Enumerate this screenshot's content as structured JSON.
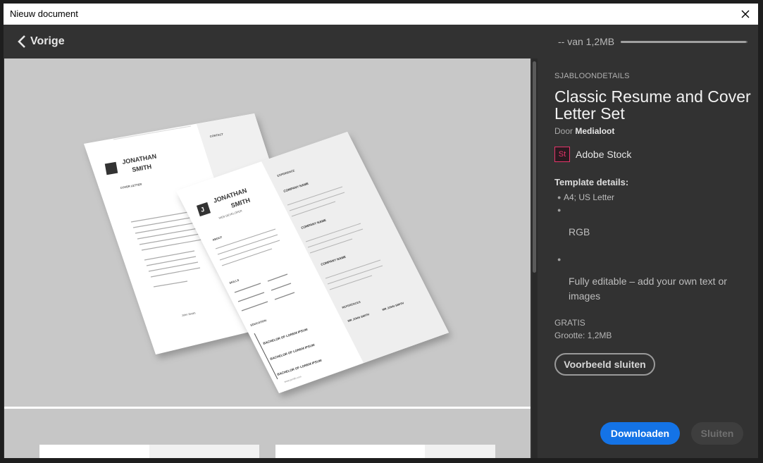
{
  "window": {
    "title": "Nieuw document"
  },
  "topbar": {
    "back_label": "Vorige",
    "progress_text": "-- van 1,2MB",
    "progress": 0.99
  },
  "details": {
    "heading": "SJABLOONDETAILS",
    "title": "Classic Resume and Cover Letter Set",
    "by_prefix": "Door",
    "author": "Medialoot",
    "source_badge": "St",
    "source": "Adobe Stock",
    "template_heading": "Template details:",
    "items": [
      "A4; US Letter",
      "RGB",
      "Fully editable – add your own text or images"
    ],
    "price": "GRATIS",
    "size": "Grootte: 1,2MB"
  },
  "buttons": {
    "preview_close": "Voorbeeld sluiten",
    "download": "Downloaden",
    "close": "Sluiten"
  },
  "resume": {
    "name_first": "JONATHAN",
    "name_last": "SMITH",
    "role": "WEB DEVELOPER",
    "monogram": "J",
    "back_contact": "CONTACT",
    "back_cover": "COVER LETTER",
    "sections": [
      "ABOUT",
      "SKILLS",
      "EDUCATION",
      "EXPERIENCE",
      "REFERENCES"
    ],
    "company": "COMPANY NAME",
    "degree": "BACHELOR OF LOREM IPSUM",
    "referee": "MR JOHN SMITH",
    "signature": "John Smith",
    "url_front": "www.jsmith.com",
    "url_back": "www.jsmith.com"
  },
  "colors": {
    "accent": "#1473e6",
    "stock": "#e6356a",
    "panel": "#323232",
    "preview_bg": "#c8c8c8"
  }
}
